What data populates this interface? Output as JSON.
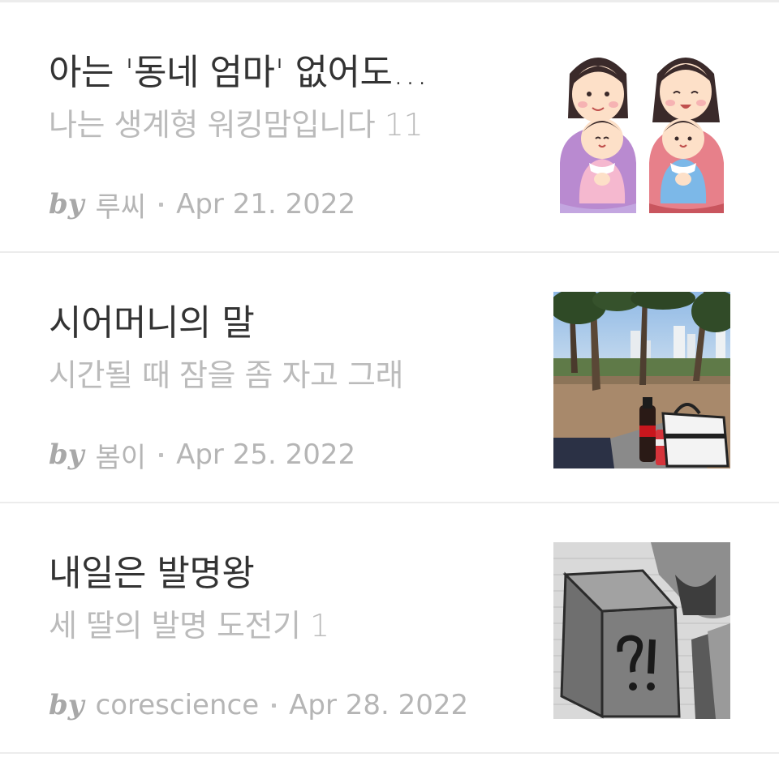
{
  "articles": [
    {
      "title": "아는 '동네 엄마' 없어도…",
      "subtitle": "나는 생계형 워킹맘입니다 11",
      "by": "by",
      "author": "루씨",
      "date": "Apr 21. 2022",
      "thumbnail_icon": "mothers-with-babies-illustration"
    },
    {
      "title": "시어머니의 말",
      "subtitle": "시간될 때 잠을 좀 자고 그래",
      "by": "by",
      "author": "봄이",
      "date": "Apr 25. 2022",
      "thumbnail_icon": "park-picnic-photo"
    },
    {
      "title": "내일은 발명왕",
      "subtitle": "세 딸의 발명 도전기 1",
      "by": "by",
      "author": "corescience",
      "date": "Apr 28. 2022",
      "thumbnail_icon": "pencil-drawing-photo"
    }
  ]
}
